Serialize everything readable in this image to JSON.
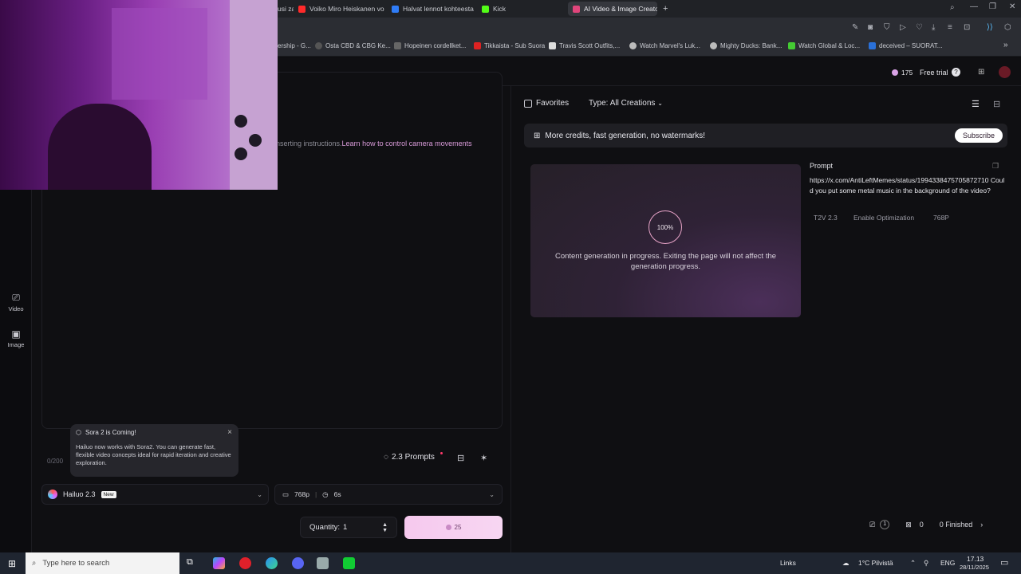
{
  "browser": {
    "tabs": [
      {
        "label": "usi za",
        "favicon_color": "#888888"
      },
      {
        "label": "Voiko Miro Heiskanen voi",
        "favicon_color": "#ff2a2a"
      },
      {
        "label": "Halvat lennot kohteesta H",
        "favicon_color": "#2f7cf6"
      },
      {
        "label": "Kick",
        "favicon_color": "#53fc18"
      },
      {
        "label": "AI Video & Image Creato",
        "favicon_color": "#e0457b",
        "active": true
      }
    ],
    "new_tab": "+",
    "bookmarks": [
      {
        "label": "ership - G..."
      },
      {
        "label": "Osta CBD & CBG Ke..."
      },
      {
        "label": "Hopeinen cordellket..."
      },
      {
        "label": "Tikkaista - Sub Suora"
      },
      {
        "label": "Travis Scott Outfits,..."
      },
      {
        "label": "Watch Marvel's Luk..."
      },
      {
        "label": "Mighty Ducks: Bank..."
      },
      {
        "label": "Watch Global & Loc..."
      },
      {
        "label": "deceived – SUORAT..."
      }
    ],
    "bookmarks_more": "»"
  },
  "header": {
    "credits": "175",
    "free_trial": "Free trial",
    "help": "?"
  },
  "left_rail": {
    "items": [
      {
        "label": "Video",
        "icon": "video-icon"
      },
      {
        "label": "Image",
        "icon": "image-icon"
      }
    ]
  },
  "editor": {
    "hint_prefix": "nserting instructions.",
    "hint_link": "Learn how to control camera movements",
    "char_count": "0/200",
    "prompts_label": "2.3 Prompts"
  },
  "tooltip": {
    "title": "Sora 2 is Coming!",
    "body": "Hailuo now works with Sora2. You can generate fast, flexible video concepts ideal for rapid iteration and creative exploration.",
    "close": "×"
  },
  "controls": {
    "model": "Hailuo 2.3",
    "model_badge": "New",
    "resolution": "768p",
    "duration": "6s",
    "quantity_label": "Quantity:",
    "quantity_value": "1",
    "generate_cost": "25"
  },
  "right_panel": {
    "favorites_label": "Favorites",
    "type_label": "Type:",
    "type_value": "All Creations",
    "promo_text": "More credits, fast generation, no watermarks!",
    "subscribe_label": "Subscribe",
    "card": {
      "progress": "100%",
      "message": "Content generation in progress. Exiting the page will not affect the generation progress."
    },
    "prompt_label": "Prompt",
    "prompt_text": "https://x.com/AntiLeftMemes/status/1994338475705872710 Could you put some metal music in the background of the video?",
    "chips": [
      "T2V 2.3",
      "Enable Optimization",
      "768P"
    ],
    "queue_count_a": "1",
    "queue_count_b": "0",
    "finished_label": "0 Finished"
  },
  "taskbar": {
    "search_placeholder": "Type here to search",
    "links": "Links",
    "weather": "1°C  Pilvistä",
    "lang": "ENG",
    "time": "17.13",
    "date": "28/11/2025"
  }
}
